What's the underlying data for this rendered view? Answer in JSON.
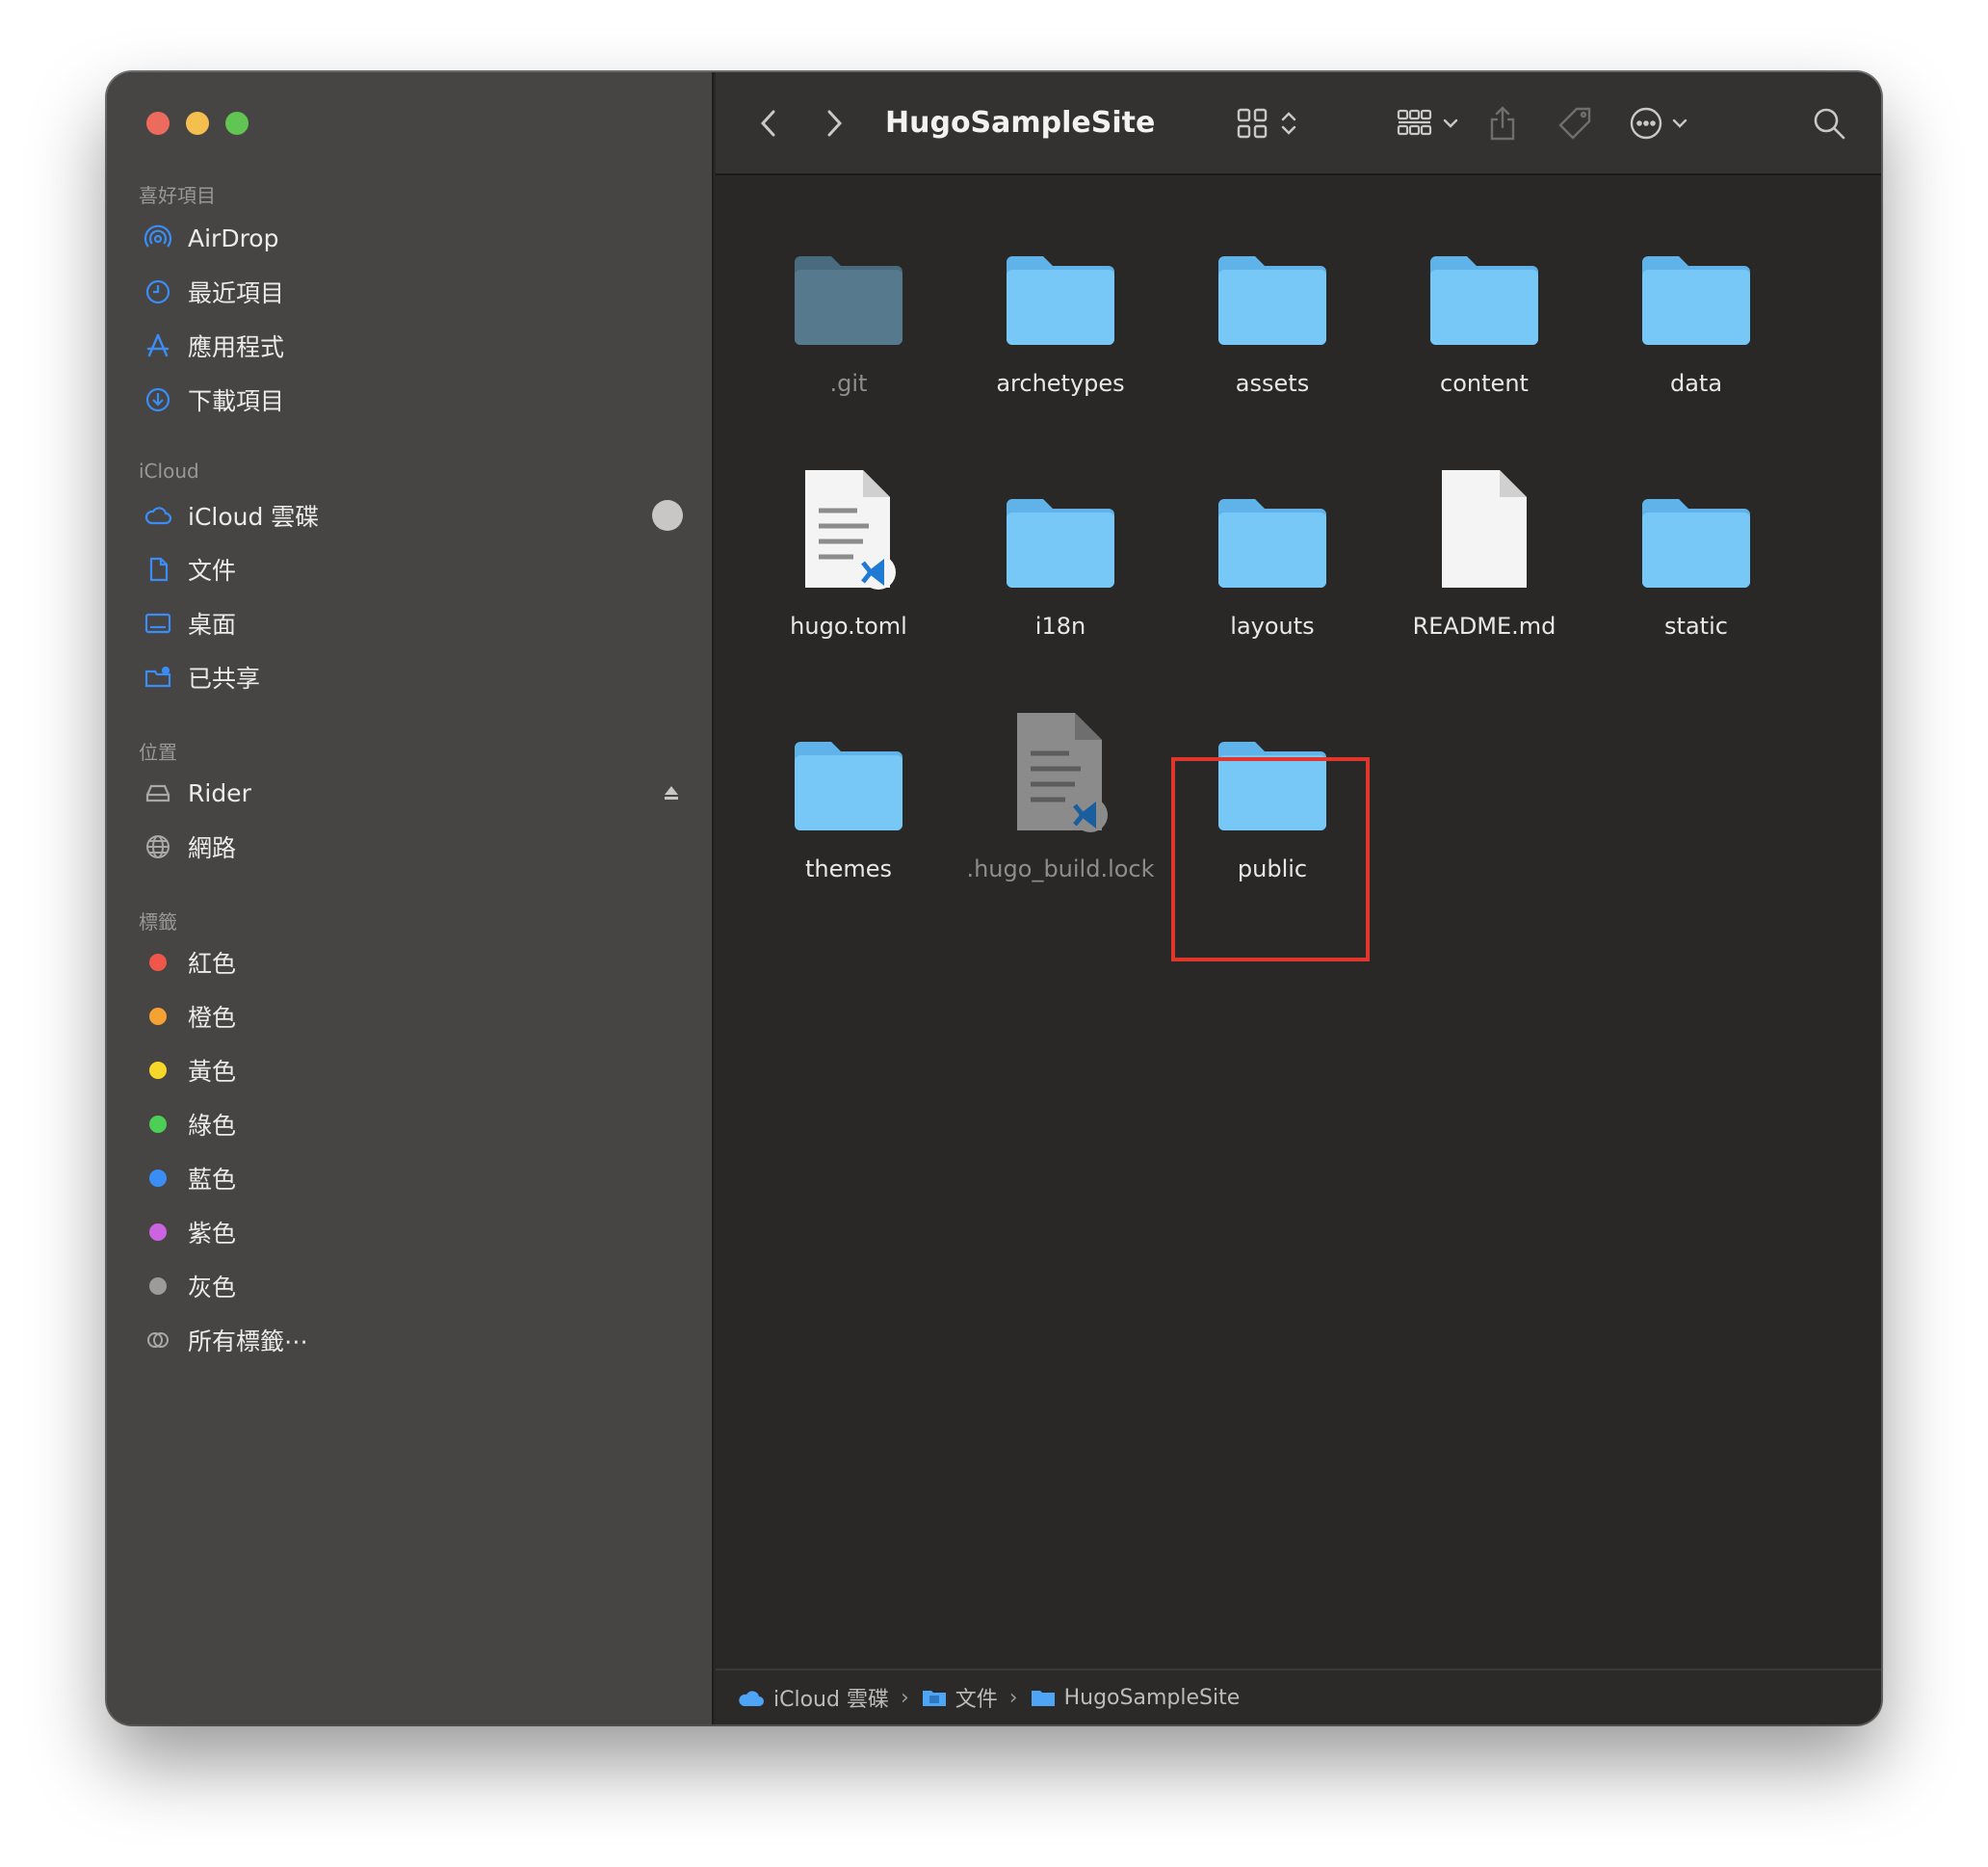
{
  "window": {
    "title": "HugoSampleSite"
  },
  "colors": {
    "folder": "#77c7f7",
    "folder_dim": "#56798e",
    "accent": "#3b8df6",
    "highlight": "#e0362b"
  },
  "sidebar": {
    "favorites_title": "喜好項目",
    "favorites": [
      {
        "label": "AirDrop",
        "icon": "airdrop-icon"
      },
      {
        "label": "最近項目",
        "icon": "clock-icon"
      },
      {
        "label": "應用程式",
        "icon": "apps-icon"
      },
      {
        "label": "下載項目",
        "icon": "download-icon"
      }
    ],
    "icloud_title": "iCloud",
    "icloud": [
      {
        "label": "iCloud 雲碟",
        "icon": "cloud-icon"
      },
      {
        "label": "文件",
        "icon": "document-icon"
      },
      {
        "label": "桌面",
        "icon": "desktop-icon"
      },
      {
        "label": "已共享",
        "icon": "shared-folder-icon"
      }
    ],
    "locations_title": "位置",
    "locations": [
      {
        "label": "Rider",
        "icon": "drive-icon"
      },
      {
        "label": "網路",
        "icon": "network-icon"
      }
    ],
    "tags_title": "標籤",
    "tags": [
      {
        "label": "紅色",
        "color": "#f0574a"
      },
      {
        "label": "橙色",
        "color": "#f5a234"
      },
      {
        "label": "黃色",
        "color": "#f7d82a"
      },
      {
        "label": "綠色",
        "color": "#4dce55"
      },
      {
        "label": "藍色",
        "color": "#3b8df6"
      },
      {
        "label": "紫色",
        "color": "#cc63e0"
      },
      {
        "label": "灰色",
        "color": "#9c9b9a"
      }
    ],
    "all_tags": "所有標籤⋯"
  },
  "files": [
    {
      "name": ".git",
      "kind": "folder",
      "dim": true
    },
    {
      "name": "archetypes",
      "kind": "folder"
    },
    {
      "name": "assets",
      "kind": "folder"
    },
    {
      "name": "content",
      "kind": "folder"
    },
    {
      "name": "data",
      "kind": "folder"
    },
    {
      "name": "hugo.toml",
      "kind": "vscode-doc"
    },
    {
      "name": "i18n",
      "kind": "folder"
    },
    {
      "name": "layouts",
      "kind": "folder"
    },
    {
      "name": "README.md",
      "kind": "blank-doc"
    },
    {
      "name": "static",
      "kind": "folder"
    },
    {
      "name": "themes",
      "kind": "folder"
    },
    {
      "name": ".hugo_build.lock",
      "kind": "vscode-doc",
      "dim": true
    },
    {
      "name": "public",
      "kind": "folder",
      "highlighted": true
    }
  ],
  "pathbar": [
    {
      "label": "iCloud 雲碟",
      "icon": "cloud-icon"
    },
    {
      "label": "文件",
      "icon": "documents-folder-icon"
    },
    {
      "label": "HugoSampleSite",
      "icon": "folder-icon"
    }
  ]
}
